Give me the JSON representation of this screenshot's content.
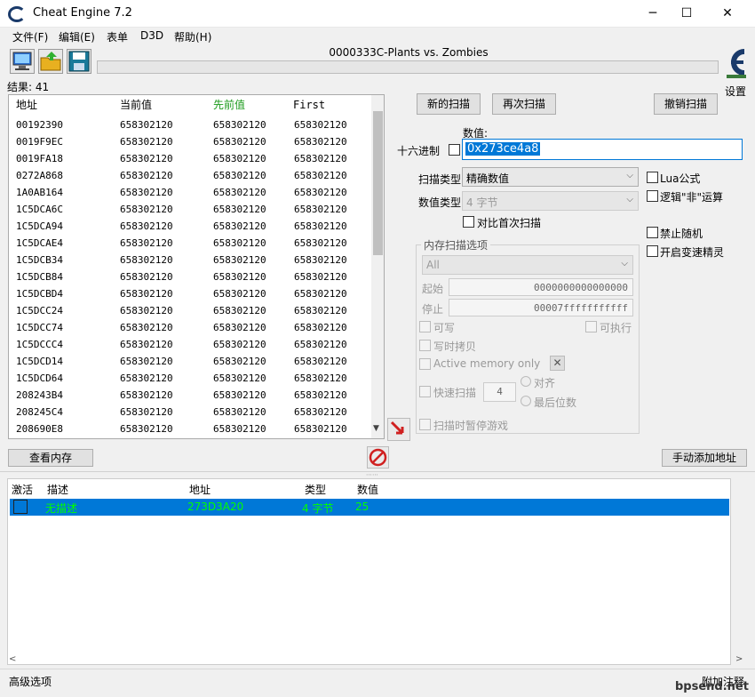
{
  "window": {
    "title": "Cheat Engine 7.2",
    "minimize": "─",
    "maximize": "☐",
    "close": "✕"
  },
  "menu": [
    "文件(F)",
    "编辑(E)",
    "表单",
    "D3D",
    "帮助(H)"
  ],
  "toolbar": {
    "process_title": "0000333C-Plants vs. Zombies",
    "settings_label": "设置"
  },
  "results": {
    "count_label": "结果: 41"
  },
  "found_list": {
    "columns": [
      "地址",
      "当前值",
      "先前值",
      "First"
    ],
    "rows": [
      [
        "00192390",
        "658302120",
        "658302120",
        "658302120"
      ],
      [
        "0019F9EC",
        "658302120",
        "658302120",
        "658302120"
      ],
      [
        "0019FA18",
        "658302120",
        "658302120",
        "658302120"
      ],
      [
        "0272A868",
        "658302120",
        "658302120",
        "658302120"
      ],
      [
        "1A0AB164",
        "658302120",
        "658302120",
        "658302120"
      ],
      [
        "1C5DCA6C",
        "658302120",
        "658302120",
        "658302120"
      ],
      [
        "1C5DCA94",
        "658302120",
        "658302120",
        "658302120"
      ],
      [
        "1C5DCAE4",
        "658302120",
        "658302120",
        "658302120"
      ],
      [
        "1C5DCB34",
        "658302120",
        "658302120",
        "658302120"
      ],
      [
        "1C5DCB84",
        "658302120",
        "658302120",
        "658302120"
      ],
      [
        "1C5DCBD4",
        "658302120",
        "658302120",
        "658302120"
      ],
      [
        "1C5DCC24",
        "658302120",
        "658302120",
        "658302120"
      ],
      [
        "1C5DCC74",
        "658302120",
        "658302120",
        "658302120"
      ],
      [
        "1C5DCCC4",
        "658302120",
        "658302120",
        "658302120"
      ],
      [
        "1C5DCD14",
        "658302120",
        "658302120",
        "658302120"
      ],
      [
        "1C5DCD64",
        "658302120",
        "658302120",
        "658302120"
      ],
      [
        "208243B4",
        "658302120",
        "658302120",
        "658302120"
      ],
      [
        "208245C4",
        "658302120",
        "658302120",
        "658302120"
      ],
      [
        "208690E8",
        "658302120",
        "658302120",
        "658302120"
      ]
    ]
  },
  "scan": {
    "new_scan": "新的扫描",
    "next_scan": "再次扫描",
    "undo_scan": "撤销扫描",
    "value_label": "数值:",
    "hex_label": "十六进制",
    "value": "0x273ce4a8",
    "scan_type_label": "扫描类型",
    "scan_type": "精确数值",
    "value_type_label": "数值类型",
    "value_type": "4 字节",
    "compare_first": "对比首次扫描",
    "lua": "Lua公式",
    "not_op": "逻辑\"非\"运算",
    "no_random": "禁止随机",
    "speedhack": "开启变速精灵"
  },
  "memory": {
    "group_title": "内存扫描选项",
    "region": "All",
    "start_label": "起始",
    "start": "0000000000000000",
    "stop_label": "停止",
    "stop": "00007fffffffffff",
    "writable": "可写",
    "executable": "可执行",
    "copy_on_write": "写时拷贝",
    "active_memory": "Active memory only",
    "fast_scan": "快速扫描",
    "fast_value": "4",
    "align": "对齐",
    "last_digits": "最后位数",
    "pause": "扫描时暂停游戏"
  },
  "buttons": {
    "view_memory": "查看内存",
    "add_manual": "手动添加地址"
  },
  "address_list": {
    "columns": [
      "激活",
      "描述",
      "地址",
      "类型",
      "数值"
    ],
    "row": {
      "desc": "无描述",
      "address": "273D3A20",
      "type": "4 字节",
      "value": "25"
    }
  },
  "footer": {
    "advanced": "高级选项",
    "comments": "附加注释"
  },
  "watermark": "bpsend.net"
}
